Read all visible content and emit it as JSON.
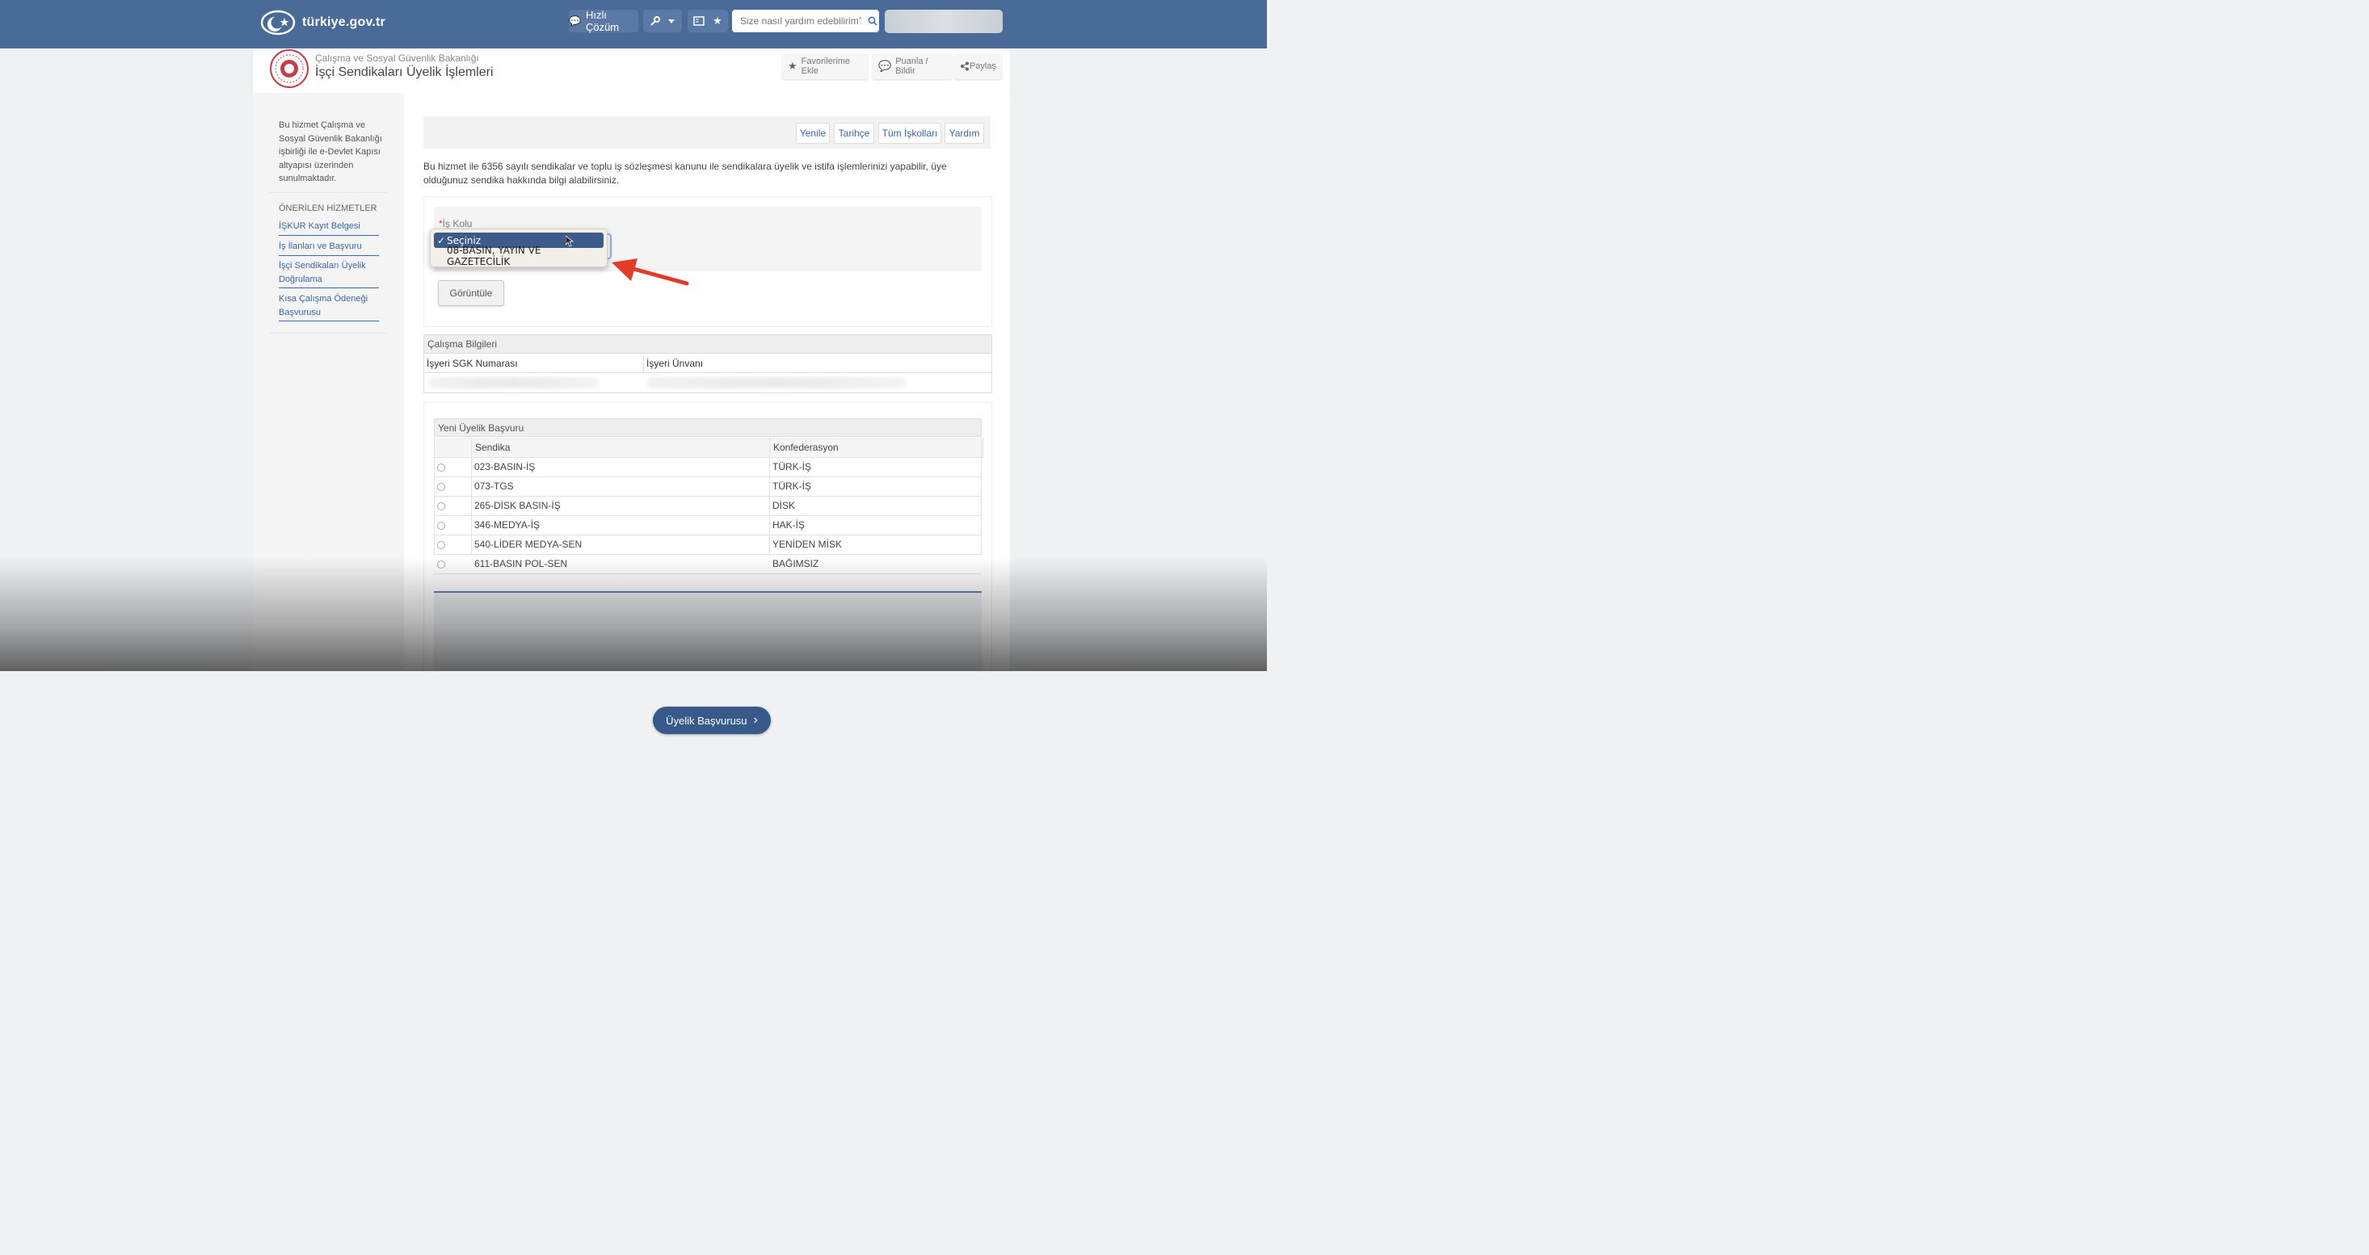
{
  "topbar": {
    "logo_text": "türkiye.gov.tr",
    "quick_solution_label": "Hızlı Çözüm",
    "search_placeholder": "Size nasıl yardım edebilirim?",
    "bg_color": "#4a6b98"
  },
  "header": {
    "ministry": "Çalışma ve Sosyal Güvenlik Bakanlığı",
    "service_title": "İşçi Sendikaları Üyelik İşlemleri",
    "buttons": [
      {
        "label": "Favorilerime Ekle",
        "icon": "star-icon"
      },
      {
        "label": "Puanla / Bildir",
        "icon": "comment-icon"
      },
      {
        "label": "Paylaş",
        "icon": "share-icon"
      }
    ]
  },
  "sidebar": {
    "info": "Bu hizmet Çalışma ve Sosyal Güvenlik Bakanlığı işbirliği ile e-Devlet Kapısı altyapısı üzerinden sunulmaktadır.",
    "recommended_title": "ÖNERİLEN HİZMETLER",
    "links": [
      "İŞKUR Kayıt Belgesi",
      "İş İlanları ve Başvuru",
      "İşçi Sendikaları Üyelik Doğrulama",
      "Kısa Çalışma Ödeneği Başvurusu"
    ]
  },
  "toolbar": {
    "buttons": [
      "Yenile",
      "Tarihçe",
      "Tüm İşkolları",
      "Yardım"
    ]
  },
  "intro": "Bu hizmet ile 6356 sayılı sendikalar ve toplu iş sözleşmesi kanunu ile sendikalara üyelik ve istifa işlemlerinizi yapabilir, üye olduğunuz sendika hakkında bilgi alabilirsiniz.",
  "form": {
    "required_mark": "*",
    "field_label": "İş Kolu",
    "options": [
      "Seçiniz",
      "08-BASIN, YAYIN VE GAZETECİLİK"
    ],
    "selected": "Seçiniz",
    "check_mark": "✓",
    "view_button": "Görüntüle"
  },
  "work_info": {
    "title": "Çalışma Bilgileri",
    "columns": [
      "İşyeri SGK Numarası",
      "İşyeri Ünvanı"
    ]
  },
  "membership": {
    "title": "Yeni Üyelik Başvuru",
    "columns": [
      "Sendika",
      "Konfederasyon"
    ],
    "rows": [
      [
        "023-BASIN-İŞ",
        "TÜRK-İŞ"
      ],
      [
        "073-TGS",
        "TÜRK-İŞ"
      ],
      [
        "265-DİSK BASIN-İŞ",
        "DİSK"
      ],
      [
        "346-MEDYA-İŞ",
        "HAK-İŞ"
      ],
      [
        "540-LİDER MEDYA-SEN",
        "YENİDEN MİSK"
      ],
      [
        "611-BASIN POL-SEN",
        "BAĞIMSIZ"
      ]
    ],
    "apply_button": "Üyelik Başvurusu",
    "apply_chevron": "›"
  },
  "colors": {
    "accent": "#3a66a8",
    "selection": "#3c5a8a",
    "arrow": "#e23b2a"
  }
}
